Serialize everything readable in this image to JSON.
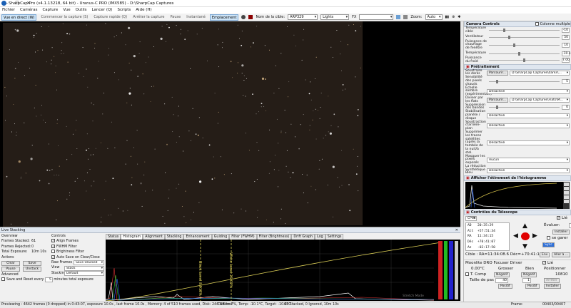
{
  "window": {
    "title": "SharpCap Pro (v4.1.13218, 64 bit) - Uranus-C PRO (IMX585) - D:\\SharpCap Captures",
    "controls": [
      "—",
      "☐",
      "✕"
    ]
  },
  "menu": [
    "Fichier",
    "Caméras",
    "Capture",
    "Vue",
    "Outils",
    "Lancer (Q)",
    "Scripts",
    "Aide (H)"
  ],
  "toolbar": {
    "live": "Vue en direct (W)",
    "capture": "Commencer la capture (S)",
    "rapid": "Capture rapide (Q)",
    "stop": "Arrêter la capture",
    "pause": "Pause",
    "snapshot": "Instantané",
    "location": "Emplacement",
    "target_label": "Nom de la cible:",
    "target_value": "ARP329",
    "frame_type": "Lights",
    "fx_label": "FX",
    "zoom_label": "Zoom:",
    "zoom_value": "Auto"
  },
  "right": {
    "camera_controls": "Camera Controls",
    "one_col": "Colonne multiple",
    "camera_rows": [
      {
        "label": "Température cible",
        "value": "-10"
      },
      {
        "label": "Ventilateur",
        "value": "50"
      },
      {
        "label": "Puissance de chauffage de fenêtre",
        "value": "10"
      },
      {
        "label": "Température",
        "value": "-10.1"
      },
      {
        "label": "Puissance du froid",
        "value": "7.00"
      }
    ],
    "preprocessing": "Prétraitement",
    "pre_rows": [
      {
        "label": "Soustraire les darks",
        "button": "Parcourir...",
        "value": "D:\\SharpCap Captures\\darks\\..."
      },
      {
        "label": "Sensibilité des pixels chauds",
        "value": "5"
      },
      {
        "label": "Échelle sombre (expérimentale)",
        "value": "Désactivé"
      },
      {
        "label": "Diviser par les flats",
        "button": "Parcourir...",
        "value": "D:\\SharpCap Captures\\Flats\\M..."
      },
      {
        "label": "Suppression des bandes",
        "value": "0"
      },
      {
        "label": "Stabilisation planète / disque",
        "value": "Désactivé"
      },
      {
        "label": "Soustraction d'arrière-plan",
        "value": "Désactivé"
      },
      {
        "label": "Supprimer les traces satellites (après la tombée de la nuit/à stel.",
        "value": "Désactivé"
      },
      {
        "label": "Masquer les pixels exposés",
        "value": "Aucun"
      },
      {
        "label": "La réduction Synthétique Bleu",
        "value": "Désactivé"
      }
    ],
    "histo_title": "Afficher l'étirement de l'histogramme",
    "telescope_title": "Contrôles du Télescope",
    "telescope": {
      "mount": "CPWI",
      "live": "Lié",
      "ad_label": "AD",
      "ad": "20:35:29",
      "alt_label": "Alt",
      "alt": "+57:51:34",
      "ra_label": "RA",
      "ra": "11:34:15",
      "dec_label": "Déc",
      "dec": "+70:41:07",
      "az_label": "Az",
      "az": "-02:17:50",
      "speed_label": "Évaluer:",
      "speed": "4x",
      "install": "Installer",
      "goto": "se garer",
      "sync": "Sync",
      "target_line": "Cible : RA=11:34:08.6 Déc=+70:41:11",
      "env": "Env",
      "goto_btn": "Aller à ..."
    },
    "focuser_title": "Moonlite DRO Focuser Driver",
    "focuser_live": "Lié",
    "focuser_temp": "0.00°C",
    "coarse": "Grosser",
    "fine": "Bien",
    "position_label": "Positionner",
    "tcomp": "T. Comp",
    "neg": "Négatif",
    "pos": "Positif",
    "pos_value": "10810",
    "step_label": "Taille de pas",
    "step_value": "40",
    "step2": "1",
    "stop": "Arrêter",
    "install": "Installer"
  },
  "stack": {
    "title": "Live Stacking",
    "overview": "Overview",
    "frames_stacked_label": "Frames Stacked:",
    "frames_stacked": "61",
    "frames_rejected_label": "Frames Rejected:",
    "frames_rejected": "0",
    "total_exposure_label": "Total Exposure:",
    "total_exposure": "10m 10s",
    "actions": "Actions",
    "clear": "Clear",
    "save": "Save",
    "pause": "Pause",
    "unstack": "Unstack",
    "advanced": "Advanced",
    "save_reset": "Save and Reset every",
    "minutes": "minutes total exposure",
    "minutes_value": "5",
    "controls": "Controls",
    "align": "Align Frames",
    "fwhm": "FWHM Filter",
    "brightness": "Brightness Filter",
    "autosave": "Auto Save on Clear/Close",
    "raw_label": "Raw Frames",
    "raw_value": "Save Stacked",
    "view_label": "View",
    "view_value": "Stack",
    "stacking_label": "Stacking",
    "stacking_value": "Default"
  },
  "tabs": [
    "Status",
    "Histogram",
    "Alignment",
    "Stacking",
    "Enhancement",
    "Guiding",
    "Filter (FWHM)",
    "Filter (Brightness)",
    "Drift Graph",
    "Log",
    "Settings"
  ],
  "histo_labels": {
    "black": "Black Level 3.918%",
    "white": "White Level 26.02%",
    "right": "Stretch Mode"
  },
  "status": {
    "text": "Previewing : 4642 frames (0 dropped) in 0:43:07, exposure 10.0s , last frame 10.0s , Memory: 4 of 510 frames used, Disk: 244 GB free",
    "cooler": "Cooler: 7%, Temp: -10.1°C, Target: -10.0°C",
    "stack": "61 Stacked, 0 Ignored, 10m 10s",
    "frame": "Frame:",
    "frame_count": "00403/00407"
  }
}
